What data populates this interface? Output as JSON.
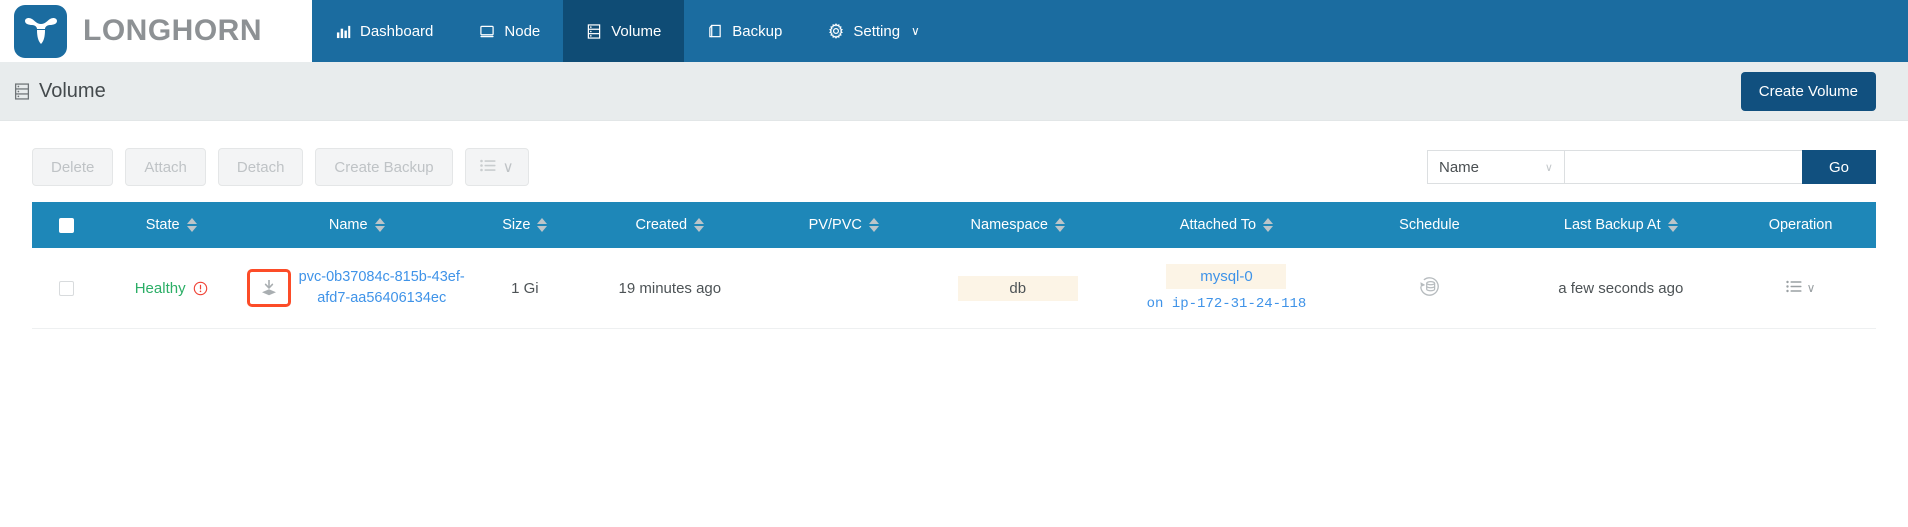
{
  "brand": {
    "name": "LONGHORN",
    "logo_icon": "longhorn-bull-icon",
    "logo_color": "#1b6ca0"
  },
  "nav": {
    "items": [
      {
        "label": "Dashboard",
        "icon": "chart-bar-icon",
        "active": false
      },
      {
        "label": "Node",
        "icon": "server-node-icon",
        "active": false
      },
      {
        "label": "Volume",
        "icon": "volume-stack-icon",
        "active": true
      },
      {
        "label": "Backup",
        "icon": "backup-copy-icon",
        "active": false
      },
      {
        "label": "Setting",
        "icon": "gear-icon",
        "active": false,
        "caret": "∨"
      }
    ],
    "background_color": "#1b6ca0",
    "active_color": "#0f4c75"
  },
  "page": {
    "title": "Volume",
    "title_icon": "volume-stack-icon",
    "create_button": "Create Volume"
  },
  "toolbar": {
    "buttons": [
      {
        "label": "Delete",
        "name": "delete-button",
        "disabled": true
      },
      {
        "label": "Attach",
        "name": "attach-button",
        "disabled": true
      },
      {
        "label": "Detach",
        "name": "detach-button",
        "disabled": true
      },
      {
        "label": "Create Backup",
        "name": "create-backup-button",
        "disabled": true
      }
    ],
    "more_menu": {
      "icon": "list-menu-icon",
      "caret": "∨"
    }
  },
  "search": {
    "field_label": "Name",
    "field_caret": "∨",
    "input_value": "",
    "placeholder": "",
    "go_label": "Go"
  },
  "table": {
    "columns": [
      {
        "key": "checkbox",
        "label": "",
        "sortable": false
      },
      {
        "key": "state",
        "label": "State",
        "sortable": true
      },
      {
        "key": "name",
        "label": "Name",
        "sortable": true
      },
      {
        "key": "size",
        "label": "Size",
        "sortable": true
      },
      {
        "key": "created",
        "label": "Created",
        "sortable": true
      },
      {
        "key": "pvpvc",
        "label": "PV/PVC",
        "sortable": true
      },
      {
        "key": "namespace",
        "label": "Namespace",
        "sortable": true
      },
      {
        "key": "attached",
        "label": "Attached To",
        "sortable": true
      },
      {
        "key": "schedule",
        "label": "Schedule",
        "sortable": false
      },
      {
        "key": "lastbackup",
        "label": "Last Backup At",
        "sortable": true
      },
      {
        "key": "operation",
        "label": "Operation",
        "sortable": false
      }
    ],
    "header_color": "#1e87b8",
    "rows": [
      {
        "state": "Healthy",
        "state_color": "#2bae66",
        "state_warning_icon": "exclamation-circle-icon",
        "restore_icon": "restore-download-icon",
        "restore_highlight_color": "#fc4c28",
        "name": "pvc-0b37084c-815b-43ef-afd7-aa56406134ec",
        "size": "1 Gi",
        "created": "19 minutes ago",
        "pvpvc": "",
        "namespace": "db",
        "attached_to": "mysql-0",
        "attached_host": "on ip-172-31-24-118",
        "schedule_icon": "recurring-snapshot-icon",
        "last_backup_at": "a few seconds ago",
        "operation_icon": "list-menu-icon",
        "operation_caret": "∨"
      }
    ]
  }
}
